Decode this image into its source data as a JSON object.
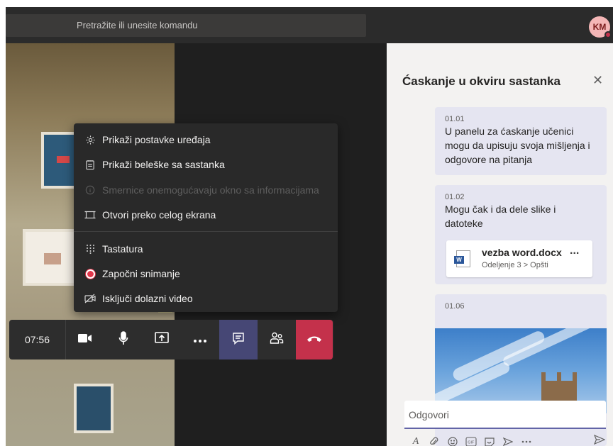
{
  "topbar": {
    "search_placeholder": "Pretražite ili unesite komandu",
    "avatar_initials": "KM"
  },
  "menu": {
    "items": [
      {
        "label": "Prikaži postavke uređaja",
        "icon": "gear-icon",
        "enabled": true
      },
      {
        "label": "Prikaži beleške sa sastanka",
        "icon": "notes-icon",
        "enabled": true
      },
      {
        "label": "Smernice onemogućavaju okno sa informacijama",
        "icon": "info-icon",
        "enabled": false
      },
      {
        "label": "Otvori preko celog ekrana",
        "icon": "fullscreen-icon",
        "enabled": true
      },
      {
        "label": "Tastatura",
        "icon": "keypad-icon",
        "enabled": true
      },
      {
        "label": "Započni snimanje",
        "icon": "record-icon",
        "enabled": true
      },
      {
        "label": "Isključi dolazni video",
        "icon": "video-off-icon",
        "enabled": true
      }
    ]
  },
  "toolbar": {
    "timer": "07:56",
    "buttons": [
      "camera-icon",
      "microphone-icon",
      "share-screen-icon",
      "more-icon",
      "chat-icon",
      "participants-icon",
      "hangup-icon"
    ],
    "hangup_color": "#c4314b",
    "active_color": "#464775"
  },
  "chat": {
    "title": "Ćaskanje u okviru sastanka",
    "messages": [
      {
        "time": "01.01",
        "text": "U panelu za ćaskanje učenici mogu da upisuju svoja mišljenja i odgovore na pitanja"
      },
      {
        "time": "01.02",
        "text": "Mogu čak i da dele slike i datoteke",
        "file": {
          "name": "vezba word.docx",
          "path": "Odeljenje 3 > Opšti",
          "more": "..."
        }
      },
      {
        "time": "01.06",
        "image": "photo of sky and castle"
      }
    ],
    "reply_placeholder": "Odgovori",
    "compose_icons": [
      "format-icon",
      "attach-icon",
      "emoji-icon",
      "gif-icon",
      "sticker-icon",
      "meet-icon",
      "more-icon"
    ]
  }
}
